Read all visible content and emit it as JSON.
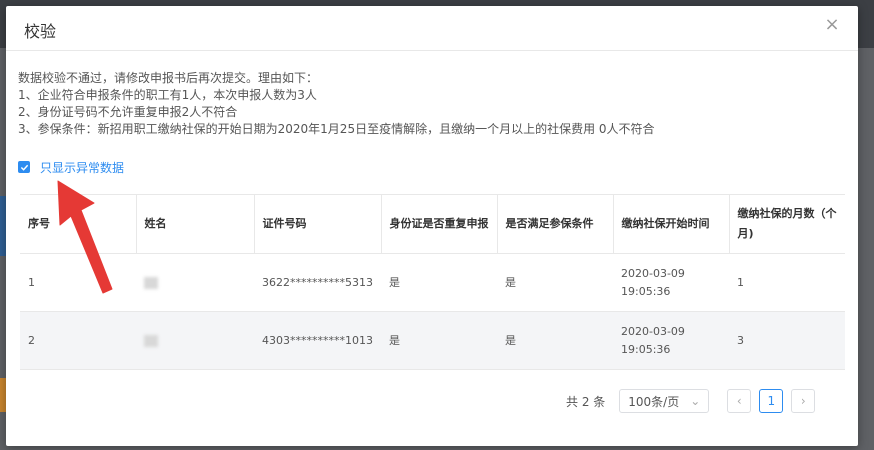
{
  "dialog": {
    "title": "校验",
    "close_icon": "×"
  },
  "message": {
    "lines": [
      "数据校验不通过，请修改申报书后再次提交。理由如下：",
      "1、企业符合申报条件的职工有1人，本次申报人数为3人",
      "2、身份证号码不允许重复申报2人不符合",
      "3、参保条件：新招用职工缴纳社保的开始日期为2020年1月25日至疫情解除，且缴纳一个月以上的社保费用 0人不符合"
    ]
  },
  "filter": {
    "checked": true,
    "label": "只显示异常数据"
  },
  "table": {
    "headers": [
      "序号",
      "姓名",
      "证件号码",
      "身份证是否重复申报",
      "是否满足参保条件",
      "缴纳社保开始时间",
      "缴纳社保的月数（个月)"
    ],
    "rows": [
      [
        "1",
        "",
        "3622**********5313",
        "是",
        "是",
        "2020-03-09 19:05:36",
        "1"
      ],
      [
        "2",
        "",
        "4303**********1013",
        "是",
        "是",
        "2020-03-09 19:05:36",
        "3"
      ]
    ]
  },
  "pagination": {
    "total": "共 2 条",
    "page_size": "100条/页",
    "current_page": "1",
    "prev_icon": "‹",
    "next_icon": "›",
    "dropdown_icon": "⌄"
  },
  "colors": {
    "accent": "#2d8cf0",
    "arrow": "#e53935"
  }
}
